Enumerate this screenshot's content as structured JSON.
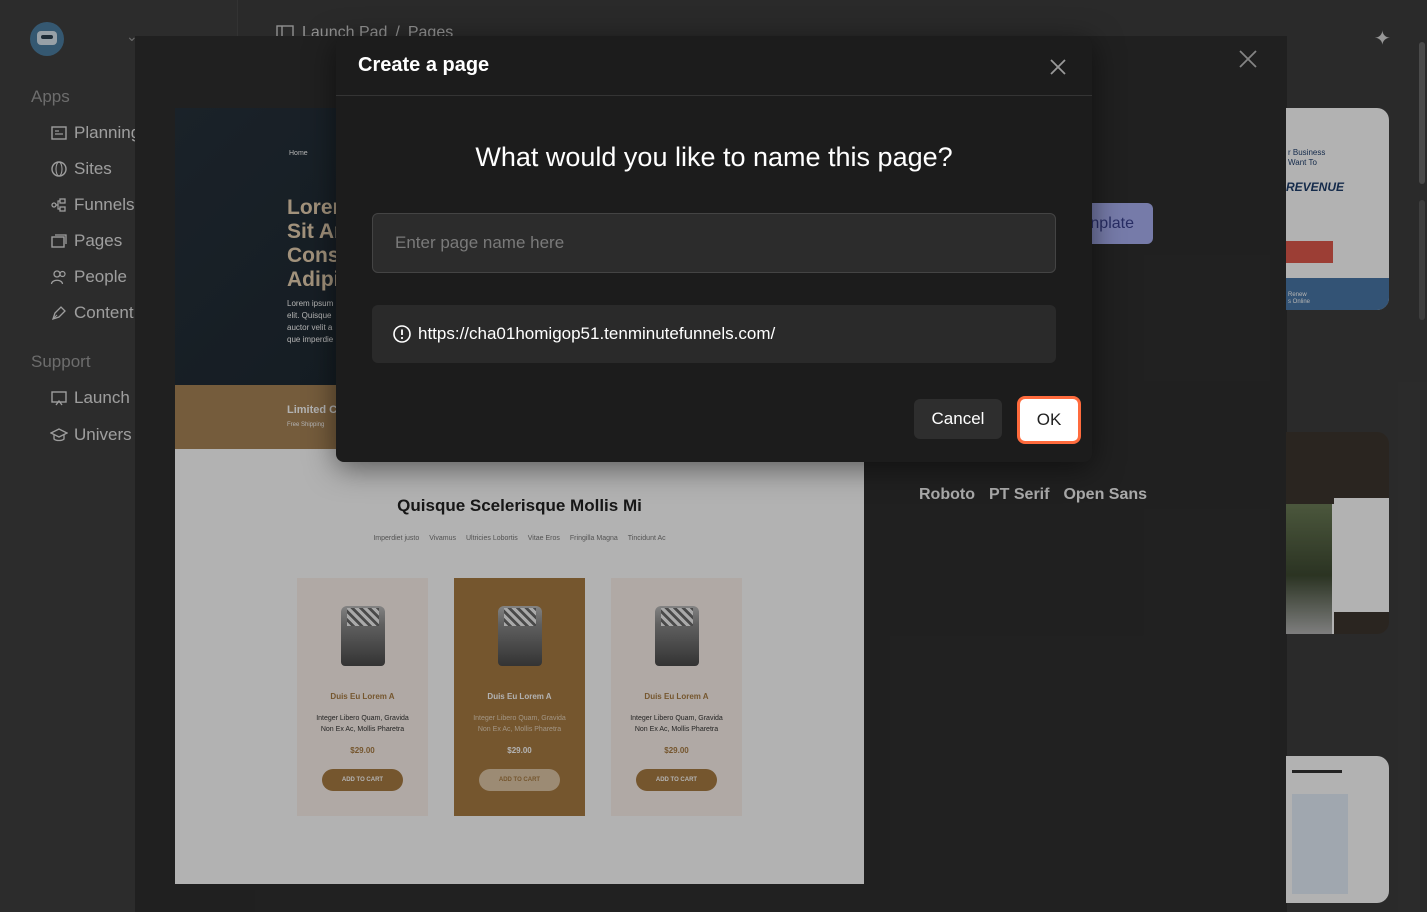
{
  "sidebar": {
    "sections": [
      {
        "title": "Apps"
      },
      {
        "title": "Support"
      }
    ],
    "apps_items": [
      {
        "label": "Planning",
        "icon": "planning-icon"
      },
      {
        "label": "Sites",
        "icon": "globe-icon"
      },
      {
        "label": "Funnels",
        "icon": "funnel-icon"
      },
      {
        "label": "Pages",
        "icon": "pages-icon"
      },
      {
        "label": "People",
        "icon": "people-icon"
      },
      {
        "label": "Content",
        "icon": "pen-icon"
      }
    ],
    "support_items": [
      {
        "label": "Launch",
        "icon": "monitor-icon"
      },
      {
        "label": "Univers",
        "icon": "graduation-cap-icon"
      }
    ]
  },
  "topbar": {
    "breadcrumb": [
      "Launch Pad",
      "/",
      "Pages"
    ]
  },
  "preview": {
    "nav_home": "Home",
    "hero_title_lines": [
      "Lorer",
      "Sit Ar",
      "Cons",
      "Adipi"
    ],
    "hero_text_lines": [
      "Lorem ipsum",
      "elit. Quisque",
      "auctor velit a",
      "que imperdie"
    ],
    "promo_title": "Limited C",
    "promo_sub": "Free Shipping",
    "products_title": "Quisque Scelerisque Mollis Mi",
    "categories": [
      "Imperdiet justo",
      "Vivamus",
      "Ultricies Lobortis",
      "Vitae Eros",
      "Fringilla Magna",
      "Tincidunt Ac"
    ],
    "cards": [
      {
        "name": "Duis Eu Lorem A",
        "desc1": "Integer Libero Quam, Gravida",
        "desc2": "Non Ex Ac, Mollis Pharetra",
        "price": "$29.00",
        "button": "ADD TO CART"
      },
      {
        "name": "Duis Eu Lorem A",
        "desc1": "Integer Libero Quam, Gravida",
        "desc2": "Non Ex Ac, Mollis Pharetra",
        "price": "$29.00",
        "button": "ADD TO CART"
      },
      {
        "name": "Duis Eu Lorem A",
        "desc1": "Integer Libero Quam, Gravida",
        "desc2": "Non Ex Ac, Mollis Pharetra",
        "price": "$29.00",
        "button": "ADD TO CART"
      }
    ]
  },
  "gallery": {
    "template_button_partial": "nplate",
    "fonts": [
      "Roboto",
      "PT Serif",
      "Open Sans"
    ],
    "thumb1_line1": "r Business",
    "thumb1_line2": "Want To",
    "thumb1_big": "REVENUE",
    "thumb1_footer1": "Renew",
    "thumb1_footer2": "s Online"
  },
  "dialog": {
    "title": "Create a page",
    "question": "What would you like to name this page?",
    "input_placeholder": "Enter page name here",
    "input_value": "",
    "url": "https://cha01homigop51.tenminutefunnels.com/",
    "cancel_label": "Cancel",
    "ok_label": "OK"
  },
  "colors": {
    "accent_focus": "#ff6b3d",
    "template_button": "#a9b1f2",
    "brand_brown": "#a87c43"
  }
}
